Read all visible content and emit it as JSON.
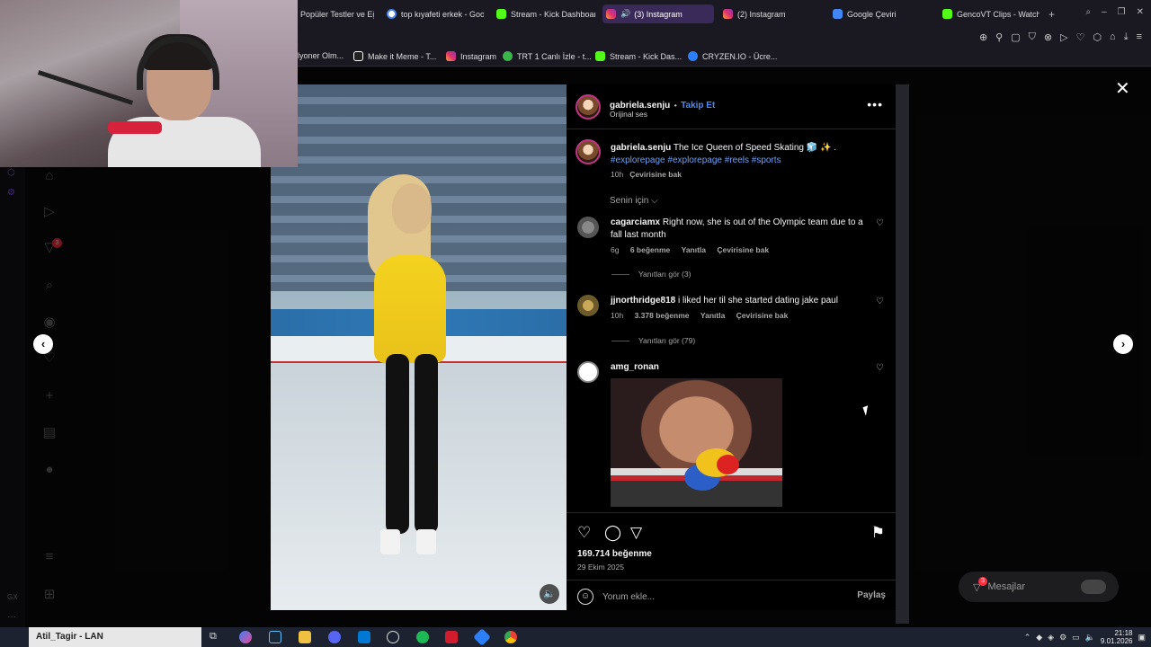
{
  "tabs": [
    {
      "label": "Popüler Testler ve Eğ",
      "active": false
    },
    {
      "label": "top kıyafeti erkek - Goog",
      "active": false
    },
    {
      "label": "Stream - Kick Dashboard",
      "active": false
    },
    {
      "label": "(3) Instagram",
      "active": true
    },
    {
      "label": "(2) Instagram",
      "active": false
    },
    {
      "label": "Google Çeviri",
      "active": false
    },
    {
      "label": "GencoVT Clips - Watch L",
      "active": false
    }
  ],
  "bookmarks": [
    "lyoner Olm...",
    "Make it Meme - T...",
    "Instagram",
    "TRT 1 Canlı İzle - t...",
    "Stream - Kick Das...",
    "CRYZEN.IO - Ücre..."
  ],
  "post": {
    "username": "gabriela.senju",
    "separator": "•",
    "follow_label": "Takip Et",
    "audio": "Orijinal ses",
    "more_label": "•••",
    "caption_text": "The Ice Queen of Speed Skating 🧊 ✨ .",
    "hashtags": "#explorepage #explorepage #reels #sports",
    "caption_age": "10h",
    "translate_label": "Çevirisine bak",
    "sort_label": "Senin için ⌵",
    "likes": "169.714 beğenme",
    "date": "29 Ekim 2025",
    "comment_placeholder": "Yorum ekle...",
    "share_label": "Paylaş"
  },
  "comments": [
    {
      "username": "cagarciamx",
      "text": "Right now, she is out of the Olympic team due to a fall last month",
      "age": "6g",
      "likes": "6 beğenme",
      "reply": "Yanıtla",
      "translate": "Çevirisine bak",
      "replies": "Yanıtları gör (3)"
    },
    {
      "username": "jjnorthridge818",
      "text": "i liked her til she started dating jake paul",
      "age": "10h",
      "likes": "3.378 beğenme",
      "reply": "Yanıtla",
      "translate": "Çevirisine bak",
      "replies": "Yanıtları gör (79)"
    },
    {
      "username": "amg_ronan",
      "text": ""
    }
  ],
  "messages_label": "Mesajlar",
  "messages_badge": "3",
  "nav_badge": "3",
  "taskbar": {
    "search_text": "Atil_Tagir - LAN",
    "time": "21:18",
    "date": "9.01.2026"
  },
  "colors": {
    "accent_link": "#4a8bf5",
    "hashtag": "#6ea1f2",
    "active_tab": "#3a2a5a",
    "kick_green": "#53fc18"
  }
}
